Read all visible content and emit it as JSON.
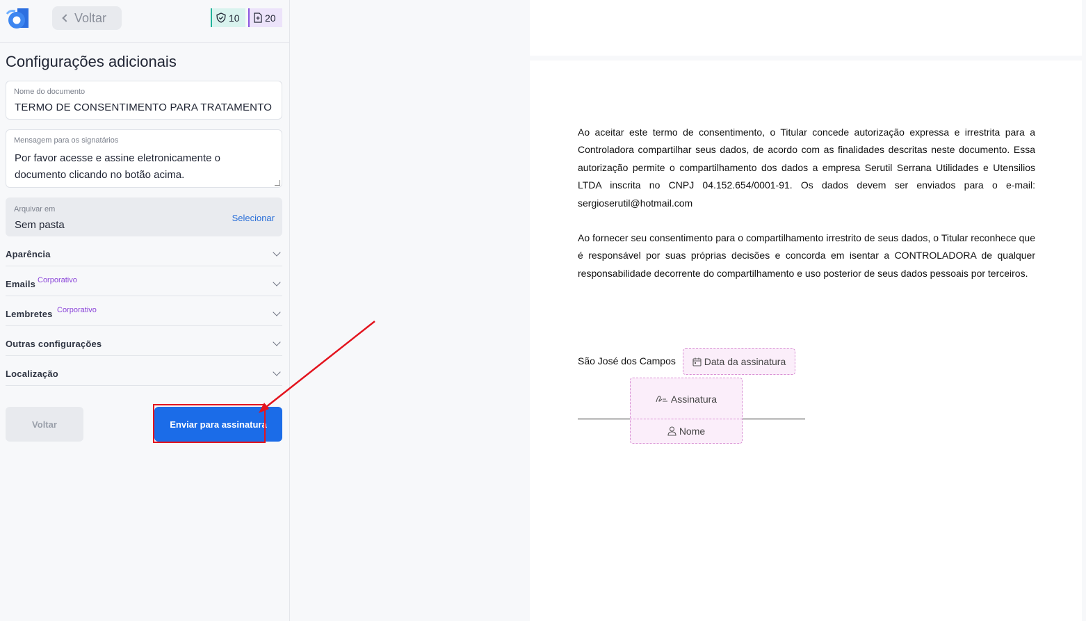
{
  "header": {
    "back_label": "Voltar",
    "badges": [
      {
        "icon": "shield-icon",
        "value": "10",
        "color": "#20b39a"
      },
      {
        "icon": "document-icon",
        "value": "20",
        "color": "#8b55e0"
      }
    ]
  },
  "title": "Configurações adicionais",
  "fields": {
    "doc_name": {
      "label": "Nome do documento",
      "value": "TERMO DE CONSENTIMENTO PARA TRATAMENTO"
    },
    "message": {
      "label": "Mensagem para os signatários",
      "value": "Por favor acesse e assine eletronicamente o documento clicando no botão acima."
    },
    "folder": {
      "label": "Arquivar em",
      "value": "Sem pasta",
      "action": "Selecionar"
    }
  },
  "accordions": [
    {
      "label": "Aparência",
      "tag": ""
    },
    {
      "label": "Emails",
      "tag": "Corporativo"
    },
    {
      "label": "Lembretes",
      "tag": "Corporativo"
    },
    {
      "label": "Outras configurações",
      "tag": ""
    },
    {
      "label": "Localização",
      "tag": ""
    }
  ],
  "actions": {
    "back": "Voltar",
    "send": "Enviar para assinatura"
  },
  "document": {
    "paragraph1": "Ao aceitar este termo de consentimento, o Titular concede autorização expressa e irrestrita para a Controladora compartilhar seus dados, de acordo com as finalidades descritas neste documento. Essa autorização permite o compartilhamento dos dados a empresa Serutil Serrana Utilidades e Utensilios LTDA inscrita no CNPJ 04.152.654/0001-91. Os dados devem ser enviados para o e-mail: sergioserutil@hotmail.com",
    "paragraph2": "Ao fornecer seu consentimento para o compartilhamento irrestrito de seus dados, o Titular reconhece que é responsável por suas próprias decisões e concorda em isentar a CONTROLADORA de qualquer responsabilidade decorrente do compartilhamento e uso posterior de seus dados pessoais por terceiros.",
    "city": "São José dos Campos",
    "date_placeholder": "Data da assinatura",
    "signature_placeholder": "Assinatura",
    "name_placeholder": "Nome"
  },
  "colors": {
    "accent": "#1b6ce8",
    "highlight": "#e3141e",
    "corporate_tag": "#8b46d9"
  }
}
